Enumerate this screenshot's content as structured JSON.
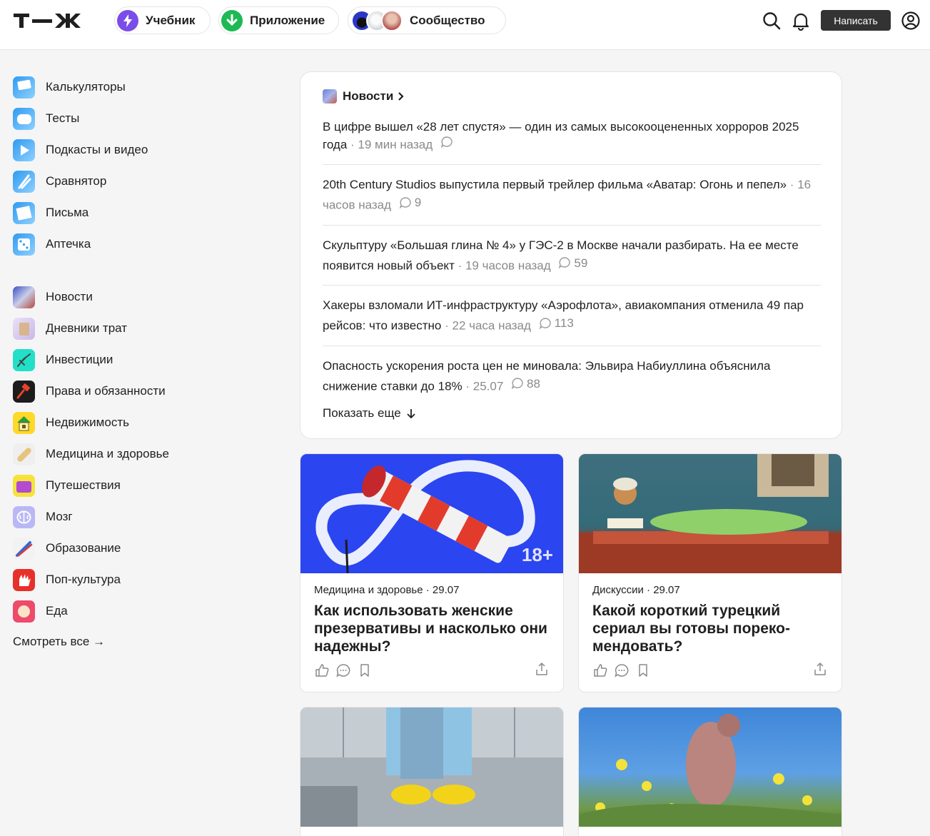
{
  "header": {
    "pills": {
      "textbook": "Учебник",
      "app": "Приложение",
      "community": "Сообщество"
    },
    "write_label": "Написать",
    "icons": [
      "search-icon",
      "bell-icon",
      "profile-icon"
    ]
  },
  "sidebar": {
    "tools": [
      {
        "label": "Калькуляторы",
        "icon": "calculator-icon"
      },
      {
        "label": "Тесты",
        "icon": "gamepad-icon"
      },
      {
        "label": "Подкасты и видео",
        "icon": "play-icon"
      },
      {
        "label": "Сравнятор",
        "icon": "compare-icon"
      },
      {
        "label": "Письма",
        "icon": "letter-icon"
      },
      {
        "label": "Аптечка",
        "icon": "dice-icon"
      }
    ],
    "sections": [
      {
        "label": "Новости",
        "icon": "news-icon"
      },
      {
        "label": "Дневники трат",
        "icon": "diary-icon"
      },
      {
        "label": "Инвестиции",
        "icon": "invest-icon"
      },
      {
        "label": "Права и обязанности",
        "icon": "gavel-icon"
      },
      {
        "label": "Недвижимость",
        "icon": "house-icon"
      },
      {
        "label": "Медицина и здоровье",
        "icon": "bandage-icon"
      },
      {
        "label": "Путешествия",
        "icon": "suitcase-icon"
      },
      {
        "label": "Мозг",
        "icon": "brain-icon"
      },
      {
        "label": "Образование",
        "icon": "education-icon"
      },
      {
        "label": "Поп-культура",
        "icon": "hand-icon"
      },
      {
        "label": "Еда",
        "icon": "food-icon"
      }
    ],
    "see_all": "Смотреть все →"
  },
  "news": {
    "title": "Новости",
    "items": [
      {
        "text": "В цифре вышел «28 лет спустя» — один из самых высокооцененных хорроров 2025 года",
        "time": "19 мин назад",
        "comments": ""
      },
      {
        "text": "20th Century Studios выпустила первый трейлер фильма «Аватар: Огонь и пепел»",
        "time": "16 часов назад",
        "comments": "9"
      },
      {
        "text": "Скульптуру «Большая глина № 4» у ГЭС-2 в Москве начали разбирать. На ее месте появится новый объект",
        "time": "19 часов назад",
        "comments": "59"
      },
      {
        "text": "Хакеры взломали ИТ-инфраструктуру «Аэрофлота», авиакомпания отменила 49 пар рейсов: что известно",
        "time": "22 часа назад",
        "comments": "113"
      },
      {
        "text": "Опасность ускорения роста цен не миновала: Эльвира Набиуллина объяснила снижение ставки до 18%",
        "time": "25.07",
        "comments": "88"
      }
    ],
    "show_more": "Показать еще"
  },
  "articles": [
    {
      "meta": "Медицина и здоровье · 29.07",
      "title": "Как использовать женские презервативы и насколько они надежны?",
      "badge": "18+"
    },
    {
      "meta": "Дискуссии · 29.07",
      "title": "Какой короткий турецкий сериал вы готовы пореко-мендовать?"
    }
  ],
  "colors": {
    "accent": "#333333",
    "background": "#f5f5f6",
    "text": "#1f1f1f",
    "muted": "#8a8a8a"
  }
}
